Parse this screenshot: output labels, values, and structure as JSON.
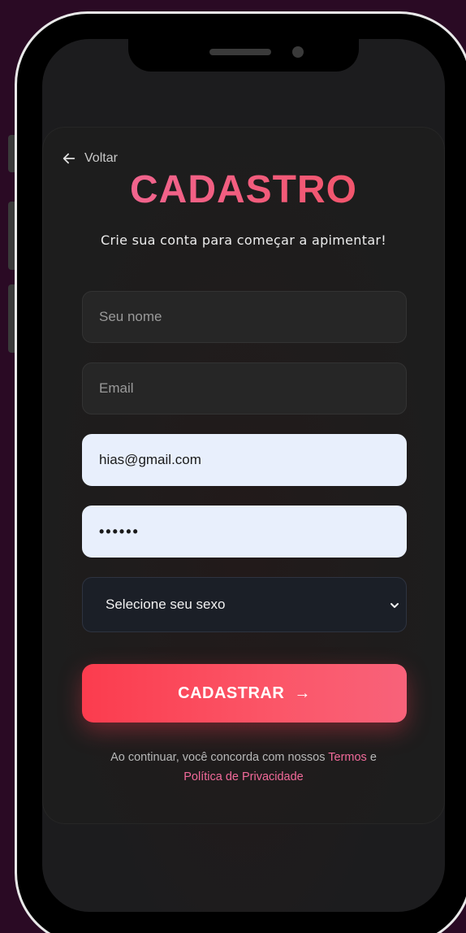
{
  "nav": {
    "back_label": "Voltar"
  },
  "header": {
    "title": "CADASTRO",
    "subtitle": "Crie sua conta para começar a apimentar!"
  },
  "form": {
    "name": {
      "placeholder": "Seu nome",
      "value": ""
    },
    "email": {
      "placeholder": "Email",
      "value": ""
    },
    "email_filled": {
      "value": "hias@gmail.com"
    },
    "password": {
      "value": "••••••"
    },
    "sex_select": {
      "selected": "Selecione seu sexo"
    },
    "submit_label": "CADASTRAR",
    "submit_arrow": "→"
  },
  "legal": {
    "prefix": "Ao continuar, você concorda com nossos",
    "terms_link": "Termos",
    "conjunction": "e",
    "privacy_link": "Política de Privacidade"
  },
  "colors": {
    "accent": "#fb3c4e",
    "link": "#f26a9a",
    "background": "#2a0a24"
  }
}
